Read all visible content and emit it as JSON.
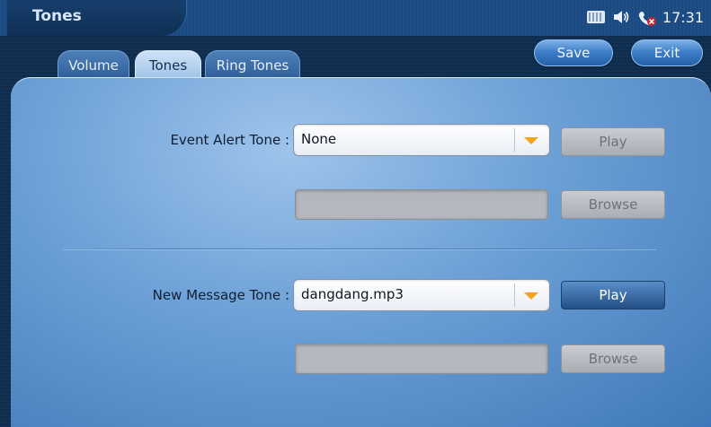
{
  "header": {
    "title": "Tones",
    "time": "17:31",
    "save_label": "Save",
    "exit_label": "Exit"
  },
  "tabs": [
    {
      "label": "Volume",
      "active": false
    },
    {
      "label": "Tones",
      "active": true
    },
    {
      "label": "Ring Tones",
      "active": false
    }
  ],
  "status_icons": [
    "keyboard-icon",
    "speaker-icon",
    "phone-missed-icon"
  ],
  "event_alert": {
    "label": "Event Alert Tone :",
    "selected": "None",
    "file_value": "",
    "play_label": "Play",
    "play_enabled": false,
    "browse_label": "Browse",
    "browse_enabled": false
  },
  "new_message": {
    "label": "New Message Tone :",
    "selected": "dangdang.mp3",
    "file_value": "",
    "play_label": "Play",
    "play_enabled": true,
    "browse_label": "Browse",
    "browse_enabled": false
  },
  "colors": {
    "accent": "#3f7fc8",
    "dropdown_arrow": "#f2a51c",
    "panel": "#6b9fd6"
  }
}
